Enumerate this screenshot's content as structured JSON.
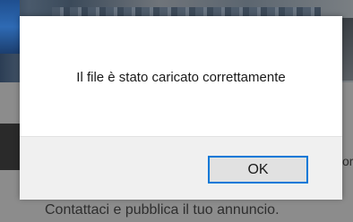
{
  "background": {
    "side_text": "or",
    "footer_text": "Contattaci e pubblica il tuo annuncio."
  },
  "dialog": {
    "message": "Il file è stato caricato correttamente",
    "ok_label": "OK"
  },
  "colors": {
    "focus_border": "#0078d7",
    "button_bg": "#e1e1e1",
    "footer_bg": "#f0f0f0",
    "overlay": "#8c8c8c"
  }
}
